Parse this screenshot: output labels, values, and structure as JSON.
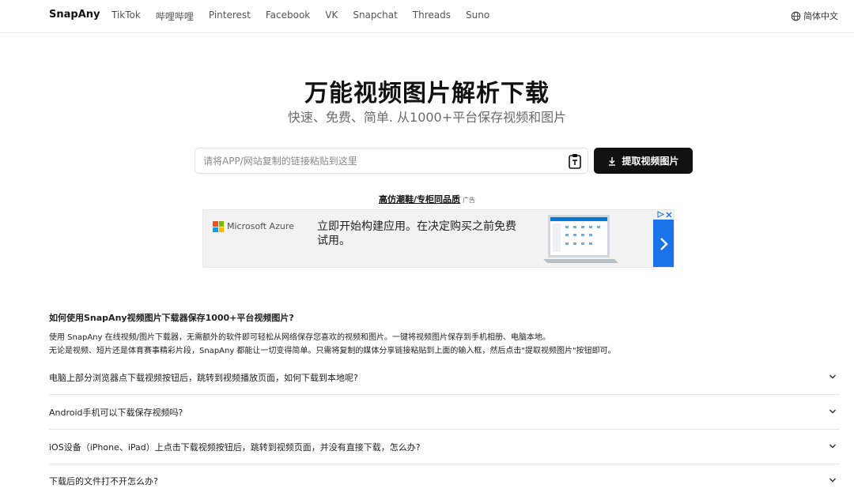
{
  "nav": {
    "brand": "SnapAny",
    "links": [
      "TikTok",
      "哔哩哔哩",
      "Pinterest",
      "Facebook",
      "VK",
      "Snapchat",
      "Threads",
      "Suno"
    ],
    "language": "简体中文"
  },
  "hero": {
    "title": "万能视频图片解析下载",
    "subtitle": "快速、免费、简单. 从1000+平台保存视频和图片"
  },
  "search": {
    "placeholder": "请将APP/网站复制的链接粘贴到这里",
    "value": "",
    "button_label": "提取视频图片"
  },
  "ad": {
    "link_text": "高仿潮鞋/专柜同品质",
    "tag": "广告",
    "banner": {
      "brand": "Microsoft Azure",
      "headline": "立即开始构建应用。在决定购买之前免费试用。",
      "choices_icon": "ad-choices-icon",
      "colors": {
        "accent": "#1a73e8"
      }
    }
  },
  "how_to": {
    "title": "如何使用SnapAny视频图片下载器保存1000+平台视频图片?",
    "lines": [
      "使用 SnapAny 在线视频/图片下载器，无需额外的软件即可轻松从网络保存您喜欢的视频和图片。一键将视频图片保存到手机相册、电脑本地。",
      "无论是视频、短片还是体育赛事精彩片段，SnapAny 都能让一切变得简单。只需将复制的媒体分享链接粘贴到上面的输入框，然后点击\"提取视频图片\"按钮即可。"
    ]
  },
  "faq": [
    {
      "question": "电脑上部分浏览器点下载视频按钮后，跳转到视频播放页面，如何下载到本地呢?"
    },
    {
      "question": "Android手机可以下载保存视频吗?"
    },
    {
      "question": "iOS设备（iPhone、iPad）上点击下载视频按钮后，跳转到视频页面，并没有直接下载，怎么办?"
    },
    {
      "question": "下载后的文件打不开怎么办?"
    }
  ],
  "colors": {
    "primary_button": "#111111",
    "background": "#ffffff"
  }
}
